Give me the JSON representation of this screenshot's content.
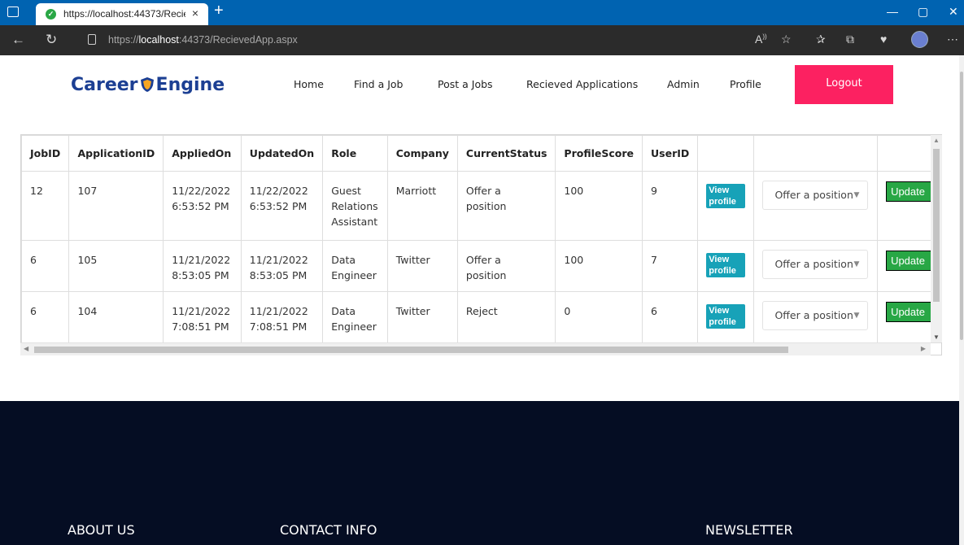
{
  "browser": {
    "tab_title": "https://localhost:44373/Recieved",
    "tab_close": "×",
    "new_tab": "+",
    "url_prefix": "https://",
    "url_host": "localhost",
    "url_rest": ":44373/RecievedApp.aspx",
    "window_controls": [
      "—",
      "▢",
      "✕"
    ]
  },
  "site": {
    "logo_left": "Career",
    "logo_right": "Engine",
    "nav": [
      "Home",
      "Find a Job",
      "Post a Jobs",
      "Recieved Applications",
      "Admin",
      "Profile"
    ],
    "logout_label": "Logout"
  },
  "grid": {
    "columns": [
      "JobID",
      "ApplicationID",
      "AppliedOn",
      "UpdatedOn",
      "Role",
      "Company",
      "CurrentStatus",
      "ProfileScore",
      "UserID",
      "",
      "",
      ""
    ],
    "rows": [
      {
        "job_id": "12",
        "application_id": "107",
        "applied_on_date": "11/22/2022",
        "applied_on_time": "6:53:52 PM",
        "updated_on_date": "11/22/2022",
        "updated_on_time": "6:53:52 PM",
        "role": [
          "Guest",
          "Relations",
          "Assistant"
        ],
        "company": "Marriott",
        "status": [
          "Offer a",
          "position"
        ],
        "profile_score": "100",
        "user_id": "9",
        "view_label": "View profile",
        "select_value": "Offer a position",
        "update_label": "Update"
      },
      {
        "job_id": "6",
        "application_id": "105",
        "applied_on_date": "11/21/2022",
        "applied_on_time": "8:53:05 PM",
        "updated_on_date": "11/21/2022",
        "updated_on_time": "8:53:05 PM",
        "role": [
          "Data",
          "Engineer"
        ],
        "company": "Twitter",
        "status": [
          "Offer a",
          "position"
        ],
        "profile_score": "100",
        "user_id": "7",
        "view_label": "View profile",
        "select_value": "Offer a position",
        "update_label": "Update"
      },
      {
        "job_id": "6",
        "application_id": "104",
        "applied_on_date": "11/21/2022",
        "applied_on_time": "7:08:51 PM",
        "updated_on_date": "11/21/2022",
        "updated_on_time": "7:08:51 PM",
        "role": [
          "Data",
          "Engineer"
        ],
        "company": "Twitter",
        "status": [
          "Reject"
        ],
        "profile_score": "0",
        "user_id": "6",
        "view_label": "View profile",
        "select_value": "Offer a position",
        "update_label": "Update"
      }
    ]
  },
  "footer": {
    "headings": [
      "ABOUT US",
      "CONTACT INFO",
      "NEWSLETTER"
    ]
  },
  "colors": {
    "tabbar": "#0063b1",
    "logout": "#fc2161",
    "view_profile": "#17a2b8",
    "update": "#28a745",
    "footer": "#050d23",
    "logo": "#1c3f93"
  },
  "icons": [
    "window-icon",
    "favicon-check-icon",
    "back-icon",
    "refresh-icon",
    "lock-icon",
    "read-aloud-icon",
    "favorite-icon",
    "favorites-icon",
    "collections-icon",
    "health-icon",
    "profile-avatar-icon",
    "more-icon",
    "shield-logo-icon"
  ]
}
